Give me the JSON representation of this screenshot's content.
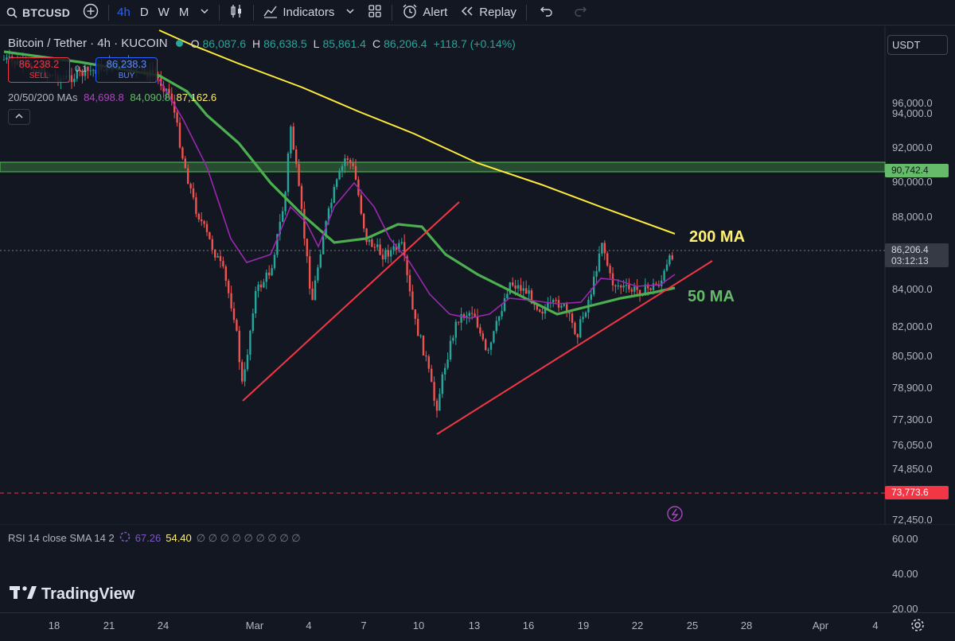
{
  "toolbar": {
    "symbol": "BTCUSD",
    "timeframes": [
      "4h",
      "D",
      "W",
      "M"
    ],
    "active_timeframe": "4h",
    "indicators_label": "Indicators",
    "alert_label": "Alert",
    "replay_label": "Replay"
  },
  "legend": {
    "title": "Bitcoin / Tether · 4h · KUCOIN",
    "o_label": "O",
    "o": "86,087.6",
    "h_label": "H",
    "h": "86,638.5",
    "l_label": "L",
    "l": "85,861.4",
    "c_label": "C",
    "c": "86,206.4",
    "change": "+118.7 (+0.14%)"
  },
  "trade": {
    "sell_price": "86,238.2",
    "sell_label": "SELL",
    "buy_price": "86,238.3",
    "buy_label": "BUY",
    "spread": "0.1"
  },
  "ma_legend": {
    "name": "20/50/200 MAs",
    "v20": "84,698.8",
    "v50": "84,090.8",
    "v200": "87,162.6"
  },
  "price_scale": {
    "currency": "USDT",
    "labels": [
      "96,000.0",
      "94,000.0",
      "92,000.0",
      "90,000.0",
      "88,000.0",
      "84,000.0",
      "82,000.0",
      "80,500.0",
      "78,900.0",
      "77,300.0",
      "76,050.0",
      "74,850.0",
      "72,450.0"
    ],
    "tag_resistance": "90,742.4",
    "tag_last": "86,206.4",
    "tag_countdown": "03:12:13",
    "tag_support": "73,773.6"
  },
  "annotations": {
    "ma200": "200 MA",
    "ma50": "50 MA"
  },
  "rsi": {
    "name": "RSI 14 close SMA 14 2",
    "rsi_value": "67.26",
    "sma_value": "54.40",
    "empties": "∅ ∅ ∅ ∅ ∅ ∅ ∅ ∅ ∅",
    "labels": [
      "60.00",
      "40.00",
      "20.00"
    ]
  },
  "watermark": "TradingView",
  "time_axis": {
    "labels": [
      "18",
      "21",
      "24",
      "Mar",
      "4",
      "7",
      "10",
      "13",
      "16",
      "19",
      "22",
      "25",
      "28",
      "Apr",
      "4"
    ]
  },
  "colors": {
    "up": "#26a69a",
    "down": "#ef5350",
    "ma20": "#9c27b0",
    "ma50": "#4caf50",
    "ma200": "#ffeb3b",
    "trendline": "#f23645"
  }
}
